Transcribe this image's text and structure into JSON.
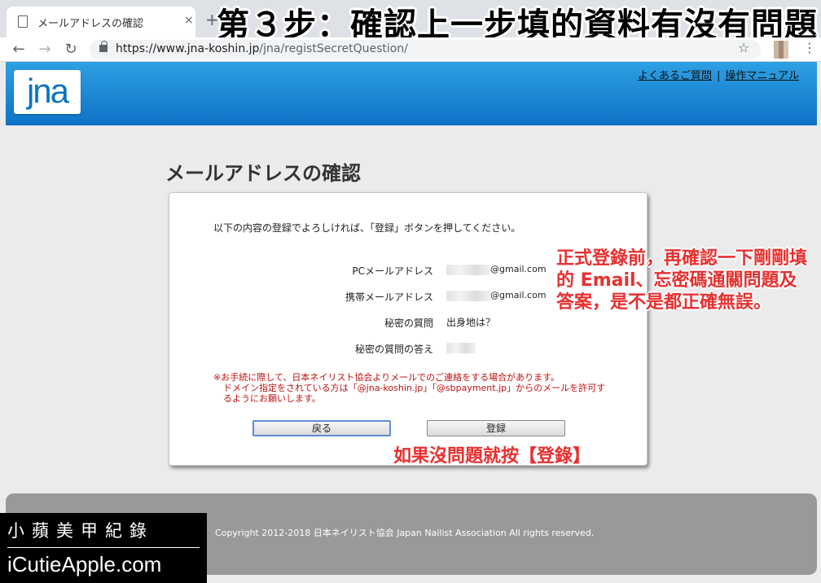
{
  "browser": {
    "tab_title": "メールアドレスの確認",
    "tab_close": "×",
    "new_tab": "+",
    "url_host": "https://www.jna-koshin.jp",
    "url_path": "/jna/registSecretQuestion/",
    "icons": {
      "back": "arrow-left-icon",
      "forward": "arrow-right-icon",
      "reload": "reload-icon",
      "lock": "lock-icon",
      "star": "star-icon",
      "menu": "kebab-menu-icon"
    }
  },
  "headline": "第３步：確認上一步填的資料有沒有問題",
  "site": {
    "logo": "jna",
    "links": [
      "よくあるご質問",
      "操作マニュアル"
    ],
    "link_separator": "|"
  },
  "page": {
    "title": "メールアドレスの確認",
    "instruction": "以下の内容の登録でよろしければ、「登録」ボタンを押してください。",
    "rows": [
      {
        "label": "PCメールアドレス",
        "value": "@gmail.com"
      },
      {
        "label": "携帯メールアドレス",
        "value": "@gmail.com"
      },
      {
        "label": "秘密の質問",
        "value": "出身地は？"
      },
      {
        "label": "秘密の質問の答え",
        "value": ""
      }
    ],
    "notice_line1": "※お手続に際して、日本ネイリスト協会よりメールでのご連絡をする場合があります。",
    "notice_line2": "ドメイン指定をされている方は「@jna-koshin.jp」「@sbpayment.jp」からのメールを許可す",
    "notice_line3": "るようにお願いします。",
    "back_button": "戻る",
    "register_button": "登録"
  },
  "annotations": {
    "right": "正式登錄前，再確認一下剛剛填的 Email、忘密碼通關問題及答案，是不是都正確無誤。",
    "bottom": "如果沒問題就按【登錄】"
  },
  "footer": {
    "copyright": "Copyright 2012-2018 日本ネイリスト協会 Japan Nailist Association All rights reserved."
  },
  "watermark": {
    "cn": "小蘋美甲紀錄",
    "en": "iCutieApple.com"
  },
  "colors": {
    "header_top": "#2ea0e3",
    "header_bottom": "#0d72c7",
    "annotation": "#e83030",
    "notice": "#c01010",
    "footer": "#999999"
  }
}
